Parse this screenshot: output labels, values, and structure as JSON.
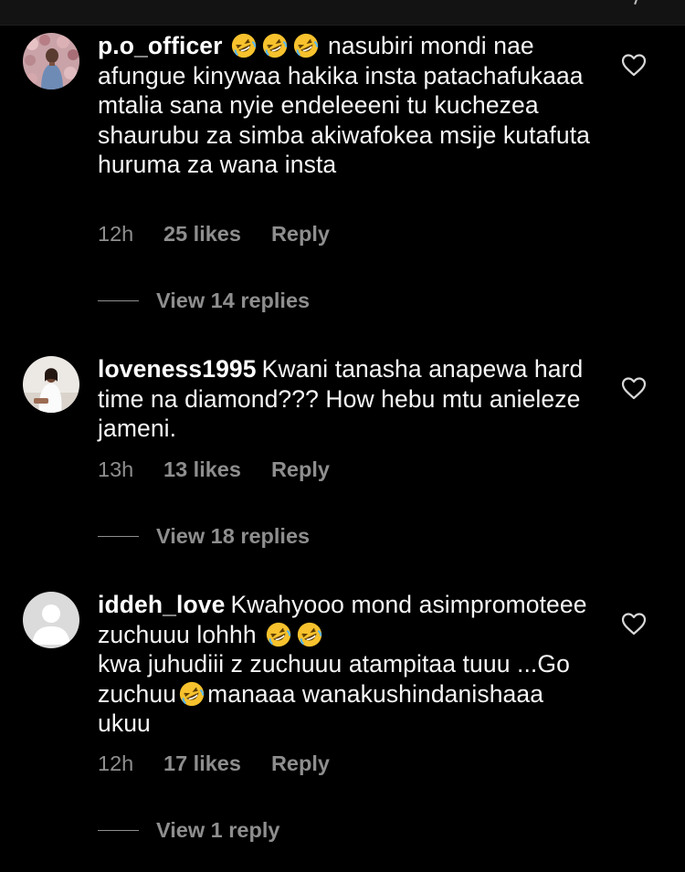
{
  "comments": [
    {
      "username": "p.o_officer",
      "text_after_emoji": "nasubiri mondi nae afungue kinywaa hakika insta patachafukaaa  mtalia sana nyie endeleeeni tu kuchezea shaurubu za simba akiwafokea msije kutafuta huruma za wana insta",
      "time": "12h",
      "likes": "25 likes",
      "reply": "Reply",
      "view_replies": "View 14 replies",
      "avatar_icon": "profile-photo-flowers"
    },
    {
      "username": "loveness1995",
      "text": "Kwani tanasha anapewa hard time na diamond??? How hebu mtu anieleze jameni.",
      "time": "13h",
      "likes": "13 likes",
      "reply": "Reply",
      "view_replies": "View 18 replies",
      "avatar_icon": "profile-photo-white-robe"
    },
    {
      "username": "iddeh_love",
      "text_part1": "Kwahyooo mond asimpromoteee zuchuuu lohhh",
      "text_part2": "kwa juhudiii z zuchuuu atampitaa tuuu ...Go zuchuu",
      "text_part3": "manaaa wanakushindanishaaa ukuu",
      "time": "12h",
      "likes": "17 likes",
      "reply": "Reply",
      "view_replies": "View 1 reply",
      "avatar_icon": "default-avatar"
    }
  ],
  "icons": {
    "like": "heart-outline-icon",
    "emoji": "rolling-on-floor-laughing-emoji"
  },
  "colors": {
    "background": "#000000",
    "text": "#ffffff",
    "secondary_text": "#8e8e8e",
    "emoji_yellow": "#f7c22d"
  }
}
